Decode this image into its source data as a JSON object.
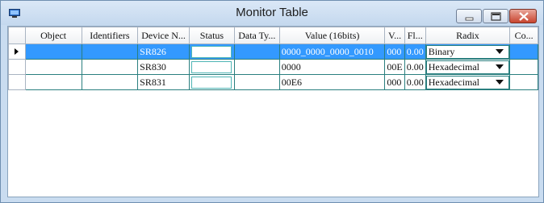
{
  "window": {
    "title": "Monitor Table",
    "controls": [
      "minimize",
      "maximize",
      "close"
    ]
  },
  "table": {
    "columns": [
      "",
      "Object",
      "Identifiers",
      "Device N...",
      "Status",
      "Data Ty...",
      "Value (16bits)",
      "V...",
      "Fl...",
      "Radix",
      "Co..."
    ],
    "rows": [
      {
        "selected": true,
        "object": "",
        "identifiers": "",
        "device": "SR826",
        "status": "",
        "data_type": "",
        "value": "0000_0000_0000_0010",
        "v": "000",
        "fl": "0.00",
        "radix": "Binary",
        "comment": ""
      },
      {
        "selected": false,
        "object": "",
        "identifiers": "",
        "device": "SR830",
        "status": "",
        "data_type": "",
        "value": "0000",
        "v": "00E",
        "fl": "0.00",
        "radix": "Hexadecimal",
        "comment": ""
      },
      {
        "selected": false,
        "object": "",
        "identifiers": "",
        "device": "SR831",
        "status": "",
        "data_type": "",
        "value": "00E6",
        "v": "000",
        "fl": "0.00",
        "radix": "Hexadecimal",
        "comment": ""
      }
    ]
  },
  "colors": {
    "selection": "#3399ff",
    "grid_line": "#2a7f7f",
    "title_bar": "#c9dcf0",
    "close_button": "#c8452f"
  }
}
